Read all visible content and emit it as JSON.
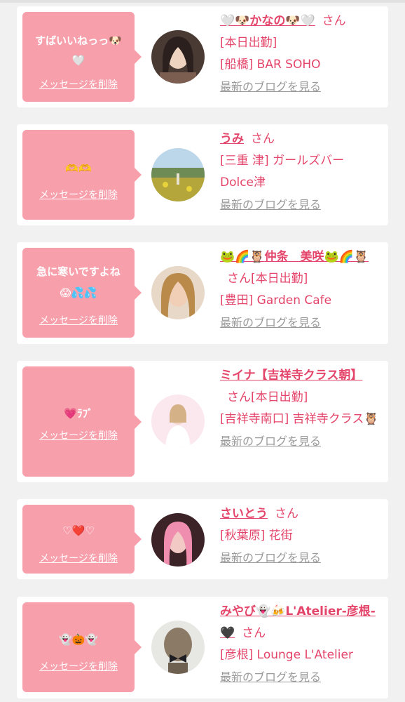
{
  "messages": [
    {
      "bubble_lines": [
        "すばいいねっっ🐶",
        "🤍"
      ],
      "delete_label": "メッセージを削除",
      "name": "🤍🐶かなの🐶🤍",
      "honorific": "さん",
      "status": "[本日出勤]",
      "location": "[船橋] BAR SOHO",
      "blog_label": "最新のブログを見る"
    },
    {
      "bubble_lines": [
        "🫶🫶"
      ],
      "delete_label": "メッセージを削除",
      "name": "うみ",
      "honorific": "さん",
      "location": "[三重 津] ガールズバー Dolce津",
      "blog_label": "最新のブログを見る"
    },
    {
      "bubble_lines": [
        "急に寒いですよね",
        "😱💦💦"
      ],
      "delete_label": "メッセージを削除",
      "name": "🐸🌈🦉仲条　美咲🐸🌈🦉",
      "honorific": "さん",
      "status": "[本日出勤]",
      "location": "[豊田] Garden Cafe",
      "blog_label": "最新のブログを見る"
    },
    {
      "bubble_lines": [
        "💗ﾗﾌﾞ"
      ],
      "delete_label": "メッセージを削除",
      "name": "ミイナ【吉祥寺クラス朝】",
      "honorific": "さん",
      "status": "[本日出勤]",
      "location": "[吉祥寺南口] 吉祥寺クラス🦉",
      "blog_label": "最新のブログを見る"
    },
    {
      "bubble_lines": [
        "♡❤️♡"
      ],
      "delete_label": "メッセージを削除",
      "name": "さいとう",
      "honorific": "さん",
      "location": "[秋葉原] 花街",
      "blog_label": "最新のブログを見る"
    },
    {
      "bubble_lines": [
        "👻🎃👻"
      ],
      "delete_label": "メッセージを削除",
      "name": "みやび👻🍻L'Atelier-彦根-🖤",
      "honorific": "さん",
      "location": "[彦根] Lounge L'Atelier",
      "blog_label": "最新のブログを見る"
    }
  ]
}
